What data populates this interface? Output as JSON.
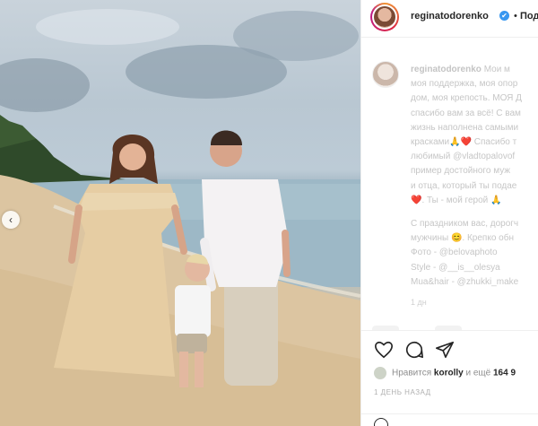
{
  "post": {
    "username": "reginatodorenko",
    "follow_label": "Подп",
    "dot": "•",
    "verified_icon": "✔",
    "caption_lines": [
      "Мои м",
      "моя поддержка, моя опор",
      "дом, моя крепость. МОЯ Д",
      "спасибо вам за всё! С вам",
      "жизнь наполнена самыми",
      "красками🙏❤️ Спасибо т",
      "любимый @vladtopalovof",
      "пример достойного муж",
      "и отца, который ты подае",
      "❤️. Ты - мой герой 🙏",
      "",
      "С праздником вас, дорогч",
      "мужчины 😊. Крепко обн",
      "Фото - @belovaphoto",
      "Style - @__is__olesya",
      "Mua&hair - @zhukki_make"
    ],
    "time_ago": "1 дн",
    "likes_prefix": "Нравится",
    "likes_user": "korolly",
    "likes_middle": "и ещё",
    "likes_count": "164 9",
    "date": "1 ДЕНЬ НАЗАД"
  },
  "icons": {
    "prev": "‹",
    "like": "heart-icon",
    "comment": "comment-icon",
    "share": "share-icon"
  }
}
